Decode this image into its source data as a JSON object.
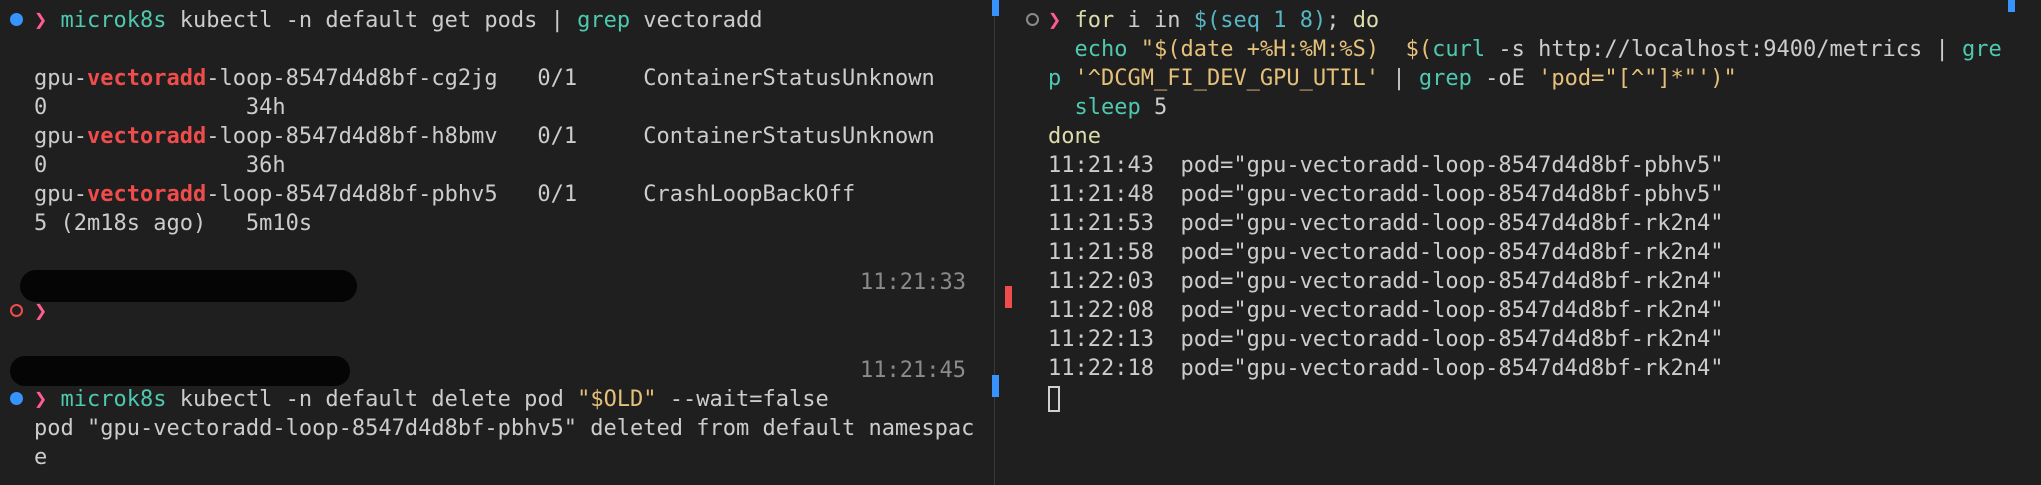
{
  "colors": {
    "background": "#1f1f1f",
    "prompt": "#ff5d8f",
    "command": "#4ec9b0",
    "keyword": "#dcdcaa",
    "string": "#e5c07b",
    "variable": "#56b6c2",
    "highlight": "#f14c4c",
    "timestamp": "#8b8b8b",
    "decoration_blue": "#3794ff",
    "decoration_red": "#f14c4c"
  },
  "left": {
    "cmd1": {
      "cmd": "microk8s",
      "args": " kubectl -n default get pods | ",
      "grep": "grep",
      "tail": " vectoradd"
    },
    "rows": [
      {
        "pre": "gpu-",
        "match": "vectoradd",
        "post": "-loop-8547d4d8bf-cg2jg   0/1     ContainerStatusUnknown",
        "line2": "0               34h"
      },
      {
        "pre": "gpu-",
        "match": "vectoradd",
        "post": "-loop-8547d4d8bf-h8bmv   0/1     ContainerStatusUnknown",
        "line2": "0               36h"
      },
      {
        "pre": "gpu-",
        "match": "vectoradd",
        "post": "-loop-8547d4d8bf-pbhv5   0/1     CrashLoopBackOff",
        "line2": "5 (2m18s ago)   5m10s"
      }
    ],
    "time1": "11:21:33",
    "time2": "11:21:45",
    "cmd2": {
      "cmd": "microk8s",
      "args": " kubectl -n default delete pod ",
      "str": "\"$OLD\"",
      "tail": " --wait=false"
    },
    "out1": "pod \"gpu-vectoradd-loop-8547d4d8bf-pbhv5\" deleted from default namespac",
    "out2": "e"
  },
  "right": {
    "l1": {
      "kw1": "for",
      "t1": " i in ",
      "var": "$(seq 1 8)",
      "t2": "; ",
      "kw2": "do"
    },
    "l2": {
      "cmd": "echo",
      "sp": " ",
      "s1": "\"$(date +%H:%M:%S)  $(",
      "curl": "curl",
      "t": " -s http://localhost:9400/metrics | ",
      "gre": "gre"
    },
    "l3": {
      "p": "p",
      "sp": " ",
      "s2": "'^DCGM_FI_DEV_GPU_UTIL'",
      "t": " | ",
      "grep": "grep",
      "t2": " -oE ",
      "s3": "'pod=\"[^\"]*\"'",
      "s4": ")\""
    },
    "l4": {
      "cmd": "sleep",
      "t": " 5"
    },
    "l5": "done",
    "output": [
      "11:21:43  pod=\"gpu-vectoradd-loop-8547d4d8bf-pbhv5\"",
      "11:21:48  pod=\"gpu-vectoradd-loop-8547d4d8bf-pbhv5\"",
      "11:21:53  pod=\"gpu-vectoradd-loop-8547d4d8bf-rk2n4\"",
      "11:21:58  pod=\"gpu-vectoradd-loop-8547d4d8bf-rk2n4\"",
      "11:22:03  pod=\"gpu-vectoradd-loop-8547d4d8bf-rk2n4\"",
      "11:22:08  pod=\"gpu-vectoradd-loop-8547d4d8bf-rk2n4\"",
      "11:22:13  pod=\"gpu-vectoradd-loop-8547d4d8bf-rk2n4\"",
      "11:22:18  pod=\"gpu-vectoradd-loop-8547d4d8bf-rk2n4\""
    ]
  }
}
